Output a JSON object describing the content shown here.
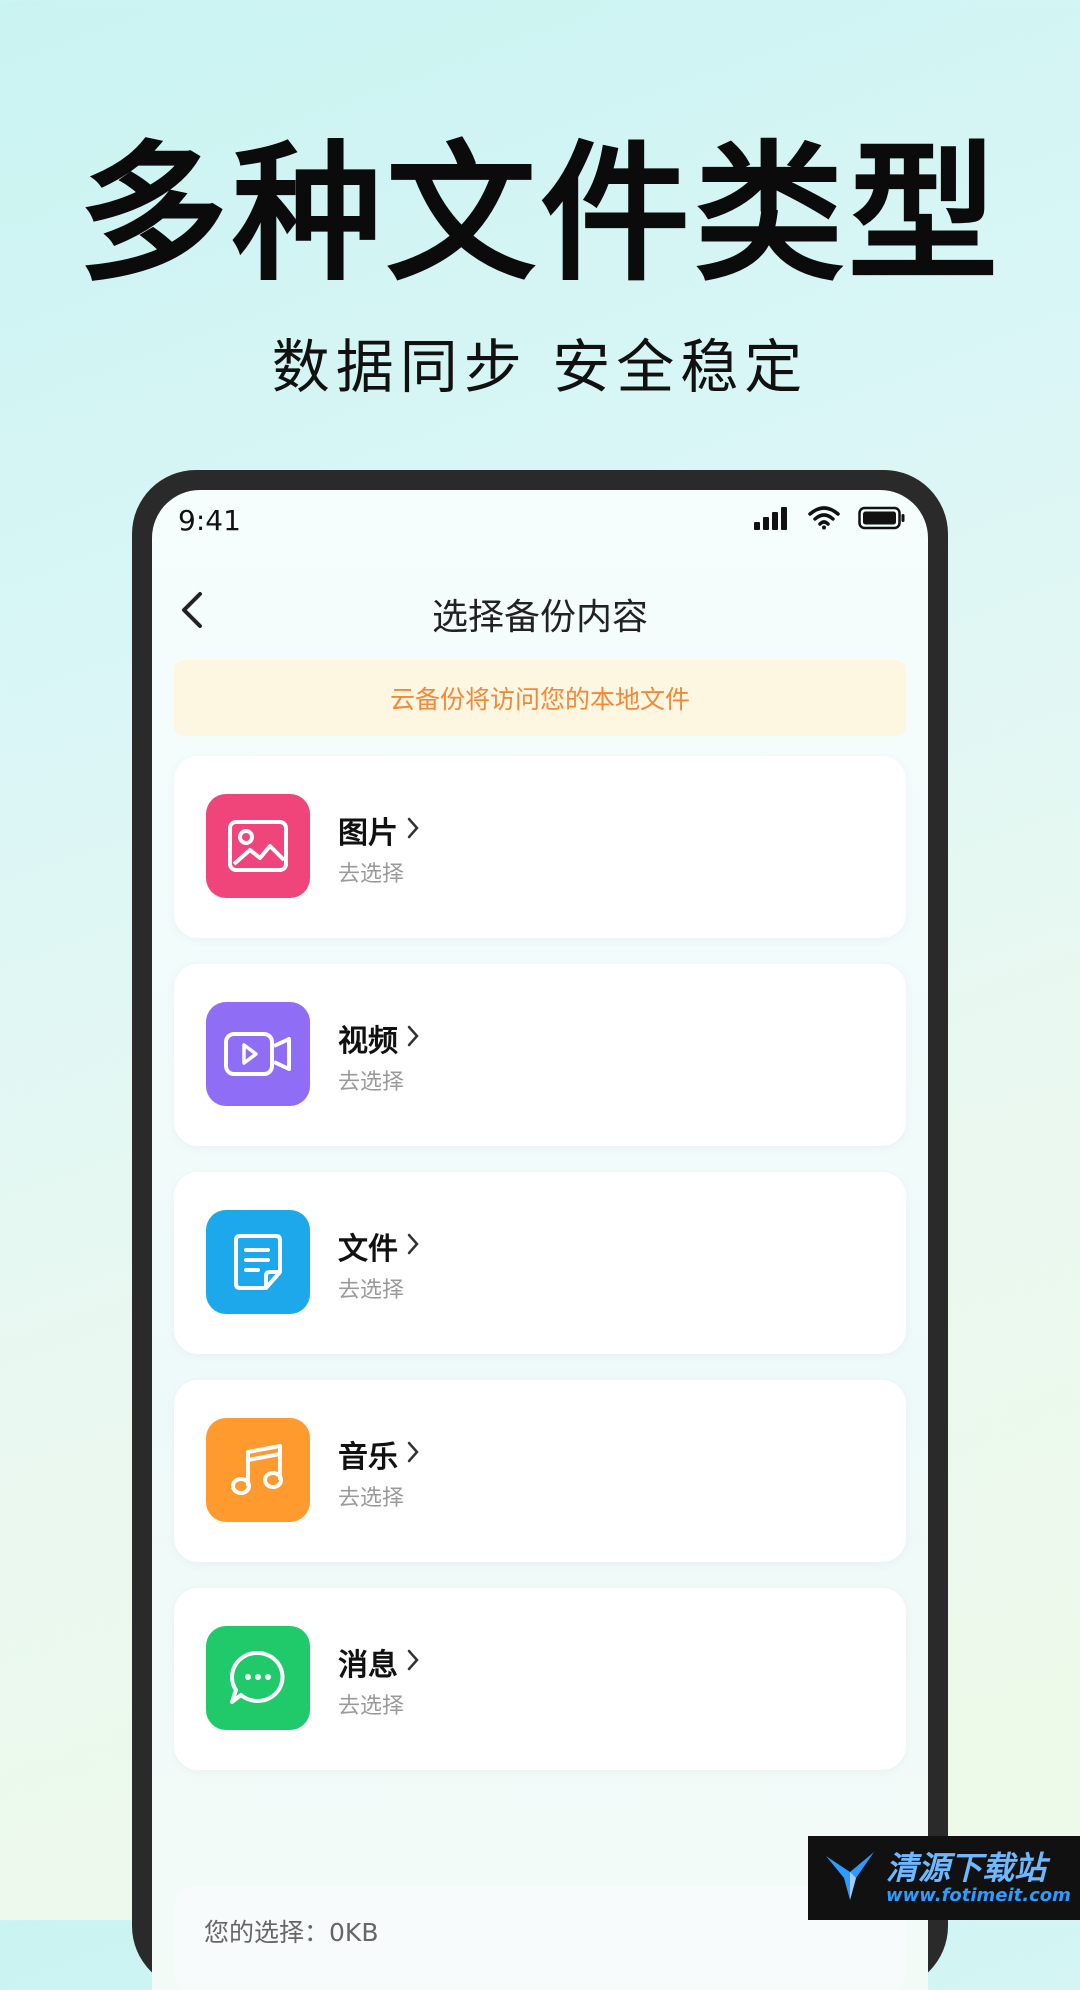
{
  "promo": {
    "title": "多种文件类型",
    "subtitle": "数据同步 安全稳定"
  },
  "status_bar": {
    "time": "9:41",
    "icons": [
      "signal-icon",
      "wifi-icon",
      "battery-icon"
    ]
  },
  "nav": {
    "back_icon": "chevron-left-icon",
    "title": "选择备份内容"
  },
  "notice": {
    "text": "云备份将访问您的本地文件"
  },
  "categories": [
    {
      "name": "图片",
      "sub": "去选择",
      "icon": "image-icon",
      "color": "#f0457b"
    },
    {
      "name": "视频",
      "sub": "去选择",
      "icon": "video-icon",
      "color": "#8f6df5"
    },
    {
      "name": "文件",
      "sub": "去选择",
      "icon": "document-icon",
      "color": "#1ea8ec"
    },
    {
      "name": "音乐",
      "sub": "去选择",
      "icon": "music-note-icon",
      "color": "#ff9b2e"
    },
    {
      "name": "消息",
      "sub": "去选择",
      "icon": "chat-bubble-icon",
      "color": "#20c96a"
    }
  ],
  "selection": {
    "label": "您的选择：",
    "value": "0KB"
  },
  "watermark": {
    "line1": "清源下载站",
    "line2": "www.fotimeit.com"
  }
}
